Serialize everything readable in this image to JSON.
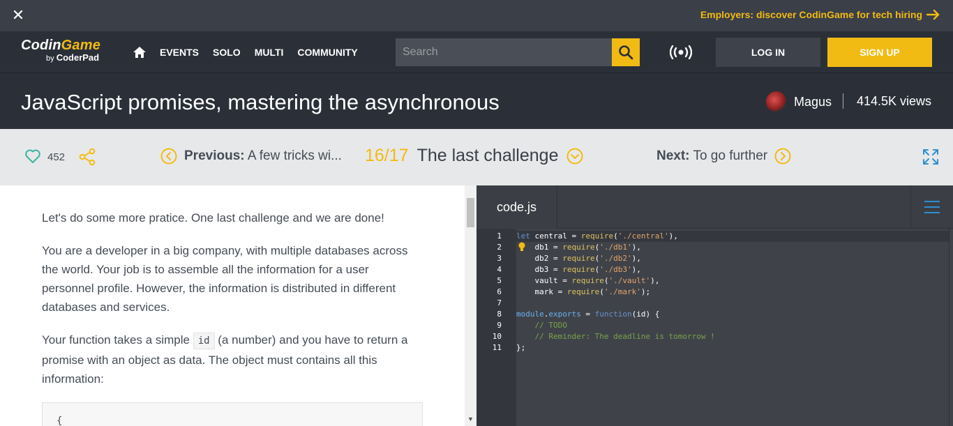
{
  "promo": {
    "link_text": "Employers: discover CodinGame for tech hiring"
  },
  "nav": {
    "logo_text_1": "Codin",
    "logo_text_2": "Game",
    "logo_by": "by",
    "logo_coderpad": "CoderPad",
    "links": [
      "EVENTS",
      "SOLO",
      "MULTI",
      "COMMUNITY"
    ],
    "search_placeholder": "Search",
    "login_label": "LOG IN",
    "signup_label": "SIGN UP"
  },
  "titlebar": {
    "title": "JavaScript promises, mastering the asynchronous",
    "author": "Magus",
    "views": "414.5K views"
  },
  "chapter": {
    "likes": "452",
    "prev_label": "Previous:",
    "prev_title": "A few tricks wi...",
    "position": "16/17",
    "current_title": "The last challenge",
    "next_label": "Next:",
    "next_title": "To go further"
  },
  "article": {
    "p1": "Let's do some more pratice. One last challenge and we are done!",
    "p2": "You are a developer in a big company, with multiple databases across the world. Your job is to assemble all the information for a user personnel profile. However, the information is distributed in different databases and services.",
    "p3_before": "Your function takes a simple ",
    "p3_code": "id",
    "p3_after": " (a number) and you have to return a promise with an object as data. The object must contains all this information:",
    "codeblock_first": "{"
  },
  "editor": {
    "tab": "code.js",
    "line_numbers": [
      "1",
      "2",
      "3",
      "4",
      "5",
      "6",
      "7",
      "8",
      "9",
      "10",
      "11"
    ],
    "lines": [
      {
        "kw": "let",
        "text": " central = ",
        "fn": "require",
        "str": "'./central'",
        "tail": "),"
      },
      {
        "indent": "    ",
        "text": "db1 = ",
        "fn": "require",
        "str": "'./db1'",
        "tail": "),"
      },
      {
        "indent": "    ",
        "text": "db2 = ",
        "fn": "require",
        "str": "'./db2'",
        "tail": "),"
      },
      {
        "indent": "    ",
        "text": "db3 = ",
        "fn": "require",
        "str": "'./db3'",
        "tail": "),"
      },
      {
        "indent": "    ",
        "text": "vault = ",
        "fn": "require",
        "str": "'./vault'",
        "tail": "),"
      },
      {
        "indent": "    ",
        "text": "mark = ",
        "fn": "require",
        "str": "'./mark'",
        "tail": ");"
      },
      {
        "text": ""
      },
      {
        "text": "module",
        "dot": ".",
        "prop": "exports",
        "eq": " = ",
        "kw": "function",
        "args": "(id) {"
      },
      {
        "comment": "    // TODO"
      },
      {
        "comment": "    // Reminder: The deadline is tomorrow !"
      },
      {
        "text": "};"
      }
    ]
  }
}
